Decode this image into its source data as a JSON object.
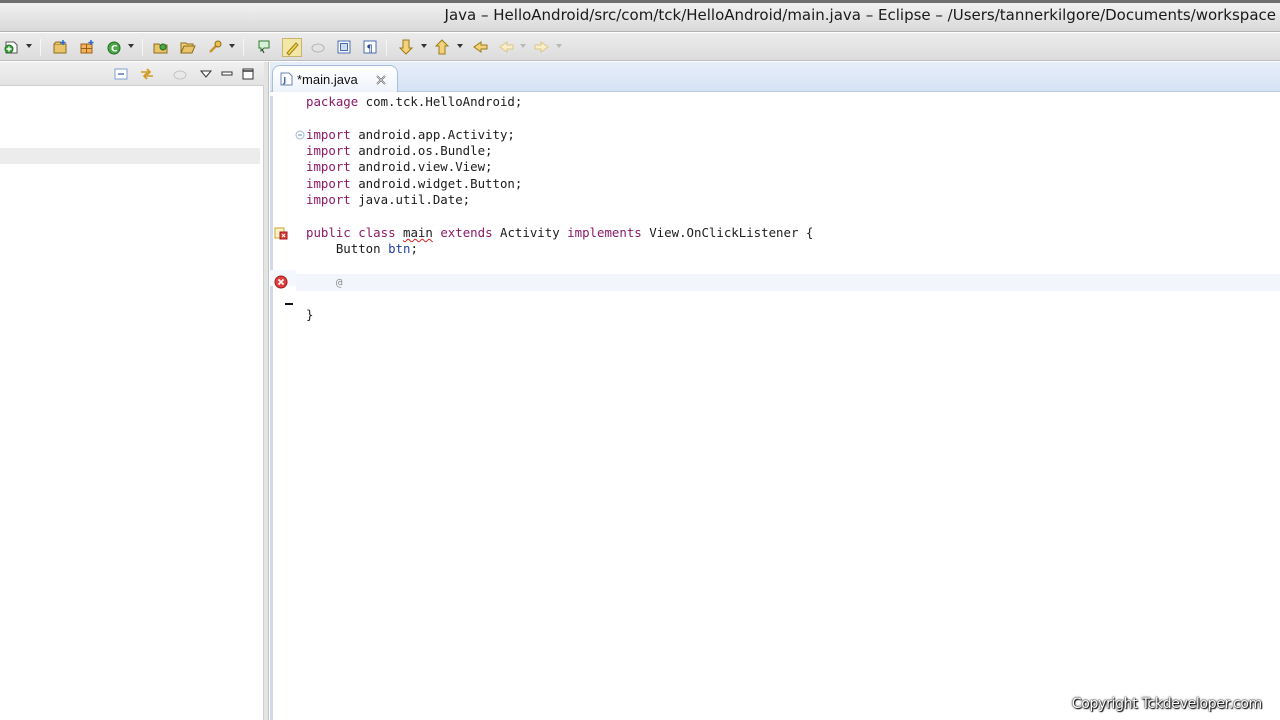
{
  "window": {
    "title": "Java – HelloAndroid/src/com/tck/HelloAndroid/main.java – Eclipse – /Users/tannerkilgore/Documents/workspace"
  },
  "toolbar": {
    "items": [
      {
        "name": "new-wizard-icon"
      },
      {
        "name": "new-java-project-icon"
      },
      {
        "name": "new-java-package-icon"
      },
      {
        "name": "new-java-class-icon"
      },
      {
        "name": "open-type-icon"
      },
      {
        "name": "open-folder-icon"
      },
      {
        "name": "search-icon"
      },
      {
        "name": "toggle-ant-editor-icon"
      },
      {
        "name": "toggle-mark-occurrences-icon"
      },
      {
        "name": "toggle-block-selection-icon"
      },
      {
        "name": "show-whitespace-icon"
      },
      {
        "name": "next-annotation-icon"
      },
      {
        "name": "previous-annotation-icon"
      },
      {
        "name": "last-edit-location-icon"
      },
      {
        "name": "back-icon"
      },
      {
        "name": "forward-icon"
      }
    ]
  },
  "left_panel": {
    "toolbar_icons": [
      "collapse-all-icon",
      "link-with-editor-icon",
      "focus-icon",
      "view-menu-icon",
      "minimize-icon",
      "maximize-icon"
    ]
  },
  "editor": {
    "tab": {
      "label": "*main.java",
      "icon": "java-file-icon",
      "close_icon": "close-icon",
      "dirty": true
    },
    "lines": [
      {
        "segments": [
          {
            "t": "package",
            "k": "kw"
          },
          {
            "t": " com.tck.HelloAndroid;"
          }
        ]
      },
      {
        "segments": []
      },
      {
        "segments": [
          {
            "t": "import",
            "k": "kw"
          },
          {
            "t": " android.app.Activity;"
          }
        ],
        "fold": "minus"
      },
      {
        "segments": [
          {
            "t": "import",
            "k": "kw"
          },
          {
            "t": " android.os.Bundle;"
          }
        ]
      },
      {
        "segments": [
          {
            "t": "import",
            "k": "kw"
          },
          {
            "t": " android.view.View;"
          }
        ]
      },
      {
        "segments": [
          {
            "t": "import",
            "k": "kw"
          },
          {
            "t": " android.widget.Button;"
          }
        ]
      },
      {
        "segments": [
          {
            "t": "import",
            "k": "kw"
          },
          {
            "t": " java.util.Date;"
          }
        ]
      },
      {
        "segments": []
      },
      {
        "segments": [
          {
            "t": "public",
            "k": "kw"
          },
          {
            "t": " "
          },
          {
            "t": "class",
            "k": "kw"
          },
          {
            "t": " "
          },
          {
            "t": "main",
            "k": "err"
          },
          {
            "t": " "
          },
          {
            "t": "extends",
            "k": "kw"
          },
          {
            "t": " Activity "
          },
          {
            "t": "implements",
            "k": "kw"
          },
          {
            "t": " View.OnClickListener {"
          }
        ],
        "marker": "warning-error-icon"
      },
      {
        "segments": [
          {
            "t": "    Button "
          },
          {
            "t": "btn",
            "k": "fld"
          },
          {
            "t": ";"
          }
        ]
      },
      {
        "segments": []
      },
      {
        "segments": [
          {
            "t": "    "
          },
          {
            "t": "@",
            "k": "at"
          }
        ],
        "marker": "error-icon",
        "current": true
      },
      {
        "segments": []
      },
      {
        "segments": [
          {
            "t": "}"
          }
        ]
      }
    ]
  },
  "watermark": "Copyright Tckdeveloper.com"
}
